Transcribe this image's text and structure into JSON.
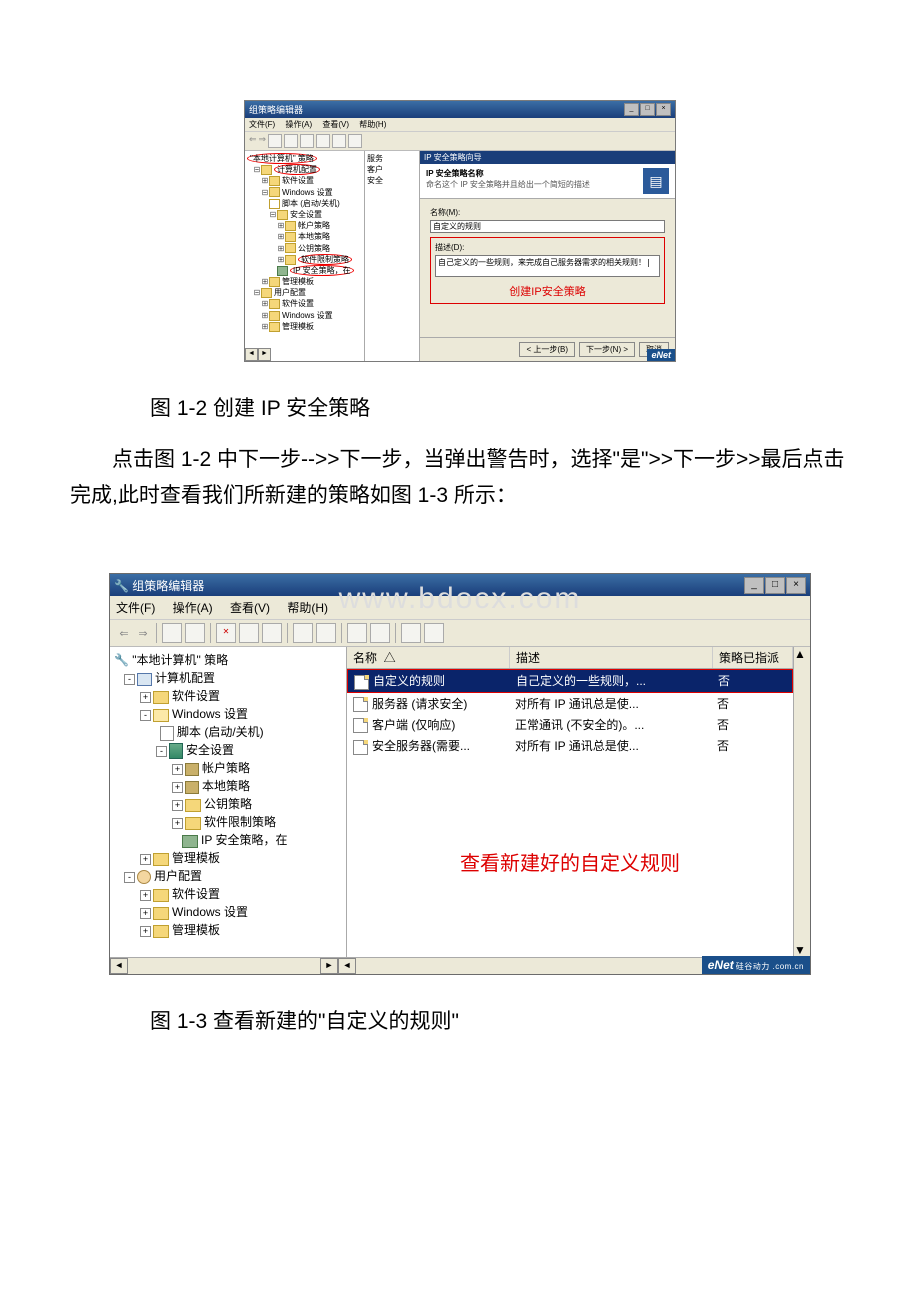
{
  "captions": {
    "fig12": "图 1-2 创建 IP 安全策略",
    "fig13": "图 1-3 查看新建的\"自定义的规则\""
  },
  "paragraph": "点击图 1-2 中下一步-->>下一步，当弹出警告时，选择\"是\">>下一步>>最后点击完成,此时查看我们所新建的策略如图 1-3 所示：",
  "small": {
    "title": "组策略编辑器",
    "menu": {
      "file": "文件(F)",
      "action": "操作(A)",
      "view": "查看(V)",
      "help": "帮助(H)"
    },
    "tree": {
      "root": "\"本地计算机\" 策略",
      "compCfg": "计算机配置",
      "swSet": "软件设置",
      "winSet": "Windows 设置",
      "script": "脚本 (启动/关机)",
      "secSet": "安全设置",
      "acctPol": "帐户策略",
      "localPol": "本地策略",
      "pkPol": "公钥策略",
      "swRest": "软件限制策略",
      "ipsec": "IP 安全策略，在",
      "admTpl": "管理模板",
      "userCfg": "用户配置",
      "swSet2": "软件设置",
      "winSet2": "Windows 设置",
      "admTpl2": "管理模板"
    },
    "center": {
      "srv": "服务",
      "cli": "客户",
      "sec": "安全"
    },
    "wizard": {
      "bar": "IP 安全策略向导",
      "heading": "IP 安全策略名称",
      "sub": "命名这个 IP 安全策略并且给出一个简短的描述",
      "nameLabel": "名称(M):",
      "nameValue": "自定义的规则",
      "descLabel": "描述(D):",
      "descValue": "自己定义的一些规则，来完成自己服务器需求的相关规则！|",
      "annot": "创建IP安全策略",
      "back": "< 上一步(B)",
      "next": "下一步(N) >",
      "cancel": "取消"
    },
    "enet": "eNet"
  },
  "large": {
    "watermark": "www.bdocx.com",
    "title": "组策略编辑器",
    "menu": {
      "file": "文件(F)",
      "action": "操作(A)",
      "view": "查看(V)",
      "help": "帮助(H)"
    },
    "tree": {
      "root": "\"本地计算机\" 策略",
      "compCfg": "计算机配置",
      "swSet": "软件设置",
      "winSet": "Windows 设置",
      "script": "脚本 (启动/关机)",
      "secSet": "安全设置",
      "acctPol": "帐户策略",
      "localPol": "本地策略",
      "pkPol": "公钥策略",
      "swRest": "软件限制策略",
      "ipsec": "IP 安全策略，在",
      "admTpl": "管理模板",
      "userCfg": "用户配置",
      "swSet2": "软件设置",
      "winSet2": "Windows 设置",
      "admTpl2": "管理模板"
    },
    "listHeader": {
      "name": "名称",
      "desc": "描述",
      "assigned": "策略已指派"
    },
    "rows": [
      {
        "name": "自定义的规则",
        "desc": "自己定义的一些规则，...",
        "assigned": "否"
      },
      {
        "name": "服务器 (请求安全)",
        "desc": "对所有 IP 通讯总是使...",
        "assigned": "否"
      },
      {
        "name": "客户端 (仅响应)",
        "desc": "正常通讯 (不安全的)。...",
        "assigned": "否"
      },
      {
        "name": "安全服务器(需要...",
        "desc": "对所有 IP 通讯总是使...",
        "assigned": "否"
      }
    ],
    "annot": "查看新建好的自定义规则",
    "enet": "eNet",
    "enetSub": "硅谷动力 .com.cn"
  }
}
